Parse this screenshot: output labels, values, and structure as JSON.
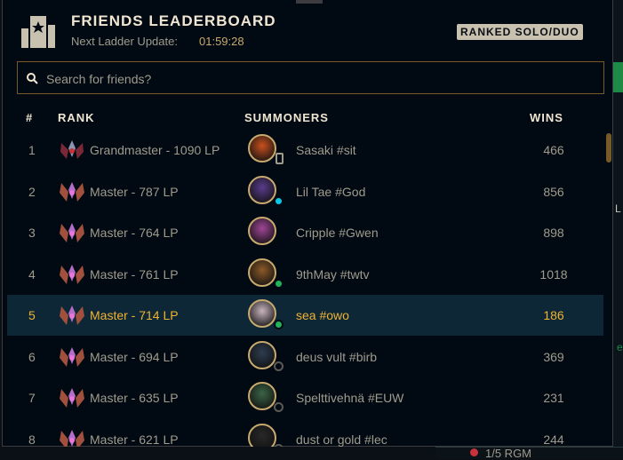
{
  "header": {
    "title": "FRIENDS LEADERBOARD",
    "next_update_label": "Next Ladder Update:",
    "next_update_time": "01:59:28",
    "queue_badge": "RANKED SOLO/DUO"
  },
  "search": {
    "placeholder": "Search for friends?"
  },
  "columns": {
    "num": "#",
    "rank": "RANK",
    "summoners": "SUMMONERS",
    "wins": "WINS"
  },
  "rows": [
    {
      "num": "1",
      "rank": "Grandmaster - 1090 LP",
      "name": "Sasaki #sit",
      "wins": "466",
      "status": "mobile",
      "avatar_color": "#c8501e"
    },
    {
      "num": "2",
      "rank": "Master - 787 LP",
      "name": "Lil Tae #God",
      "wins": "856",
      "status": "away",
      "avatar_color": "#5a3c8c"
    },
    {
      "num": "3",
      "rank": "Master - 764 LP",
      "name": "Cripple #Gwen",
      "wins": "898",
      "status": "none",
      "avatar_color": "#a04696"
    },
    {
      "num": "4",
      "rank": "Master - 761 LP",
      "name": "9thMay #twtv",
      "wins": "1018",
      "status": "online",
      "avatar_color": "#8c5a28"
    },
    {
      "num": "5",
      "rank": "Master - 714 LP",
      "name": "sea #owo",
      "wins": "186",
      "status": "online",
      "avatar_color": "#c8b4be",
      "selected": true
    },
    {
      "num": "6",
      "rank": "Master - 694 LP",
      "name": "deus vult #birb",
      "wins": "369",
      "status": "offline",
      "avatar_color": "#2d3c50"
    },
    {
      "num": "7",
      "rank": "Master - 635 LP",
      "name": "Spelttivehnä #EUW",
      "wins": "231",
      "status": "offline",
      "avatar_color": "#3c6446"
    },
    {
      "num": "8",
      "rank": "Master - 621 LP",
      "name": "dust or gold #lec",
      "wins": "244",
      "status": "offline",
      "avatar_color": "#282828"
    }
  ],
  "colors": {
    "gold": "#c8aa6e",
    "selected_text": "#f0b232",
    "online": "#1fb45a",
    "away": "#0ac8e6"
  },
  "background_strip": {
    "letter_l": "L",
    "letter_e": "e",
    "bottom_text": "1/5 RGM"
  }
}
